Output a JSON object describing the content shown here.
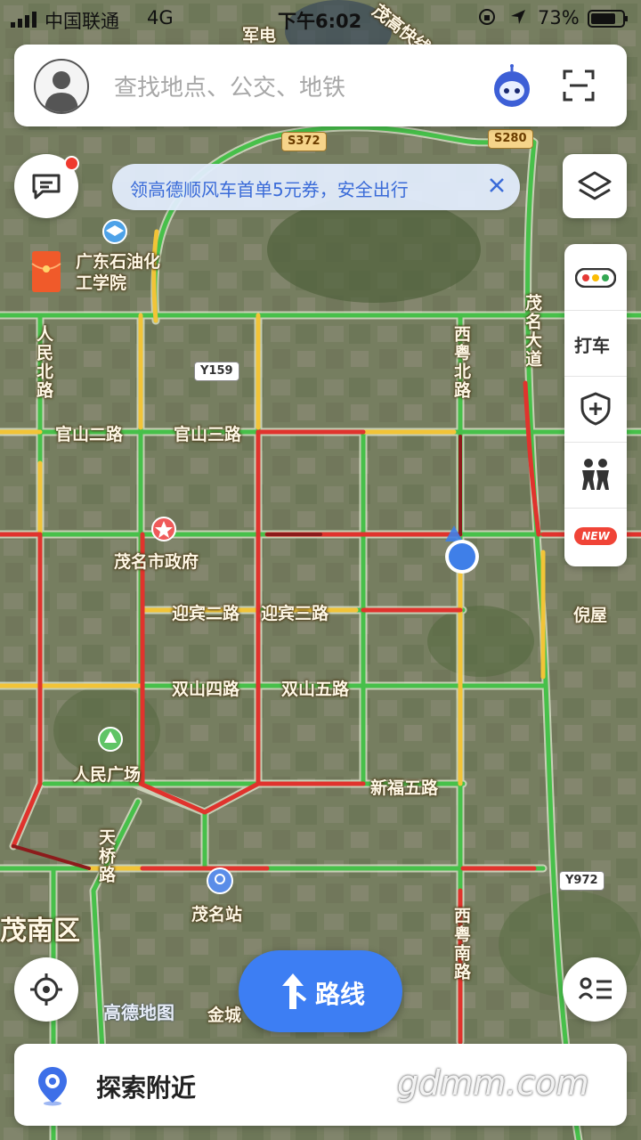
{
  "status_bar": {
    "carrier": "中国联通",
    "network": "4G",
    "time": "下午6:02",
    "battery": "73%"
  },
  "search": {
    "placeholder": "查找地点、公交、地铁"
  },
  "promo": {
    "text": "领高德顺风车首单5元券，安全出行"
  },
  "side_tools": {
    "taxi": "打车",
    "new_badge": "NEW"
  },
  "map": {
    "places": [
      {
        "name": "广东石油化工学院"
      },
      {
        "name": "茂名市政府"
      },
      {
        "name": "人民广场"
      },
      {
        "name": "茂名站"
      },
      {
        "name": "倪屋"
      },
      {
        "name": "茂南区"
      },
      {
        "name": "军电"
      }
    ],
    "roads": {
      "guanshan2": "官山二路",
      "guanshan3": "官山三路",
      "yingbin2": "迎宾二路",
      "yingbin3": "迎宾三路",
      "shuangshan4": "双山四路",
      "shuangshan5": "双山五路",
      "xinfu5": "新福五路",
      "renmin_bei": "人民北路",
      "xiyue_bei": "西粤北路",
      "xiyue_nan": "西粤南路",
      "maoming_dadao": "茂名大道",
      "tianqiao": "天桥路",
      "jincheng": "金城",
      "gaosu": "茂高快线"
    },
    "badges": {
      "s372": "S372",
      "s280": "S280",
      "y159": "Y159",
      "y972": "Y972"
    },
    "brand": "高德地图",
    "watermark": "gdmm.com"
  },
  "buttons": {
    "route": "路线"
  },
  "bottom": {
    "explore": "探索附近"
  }
}
